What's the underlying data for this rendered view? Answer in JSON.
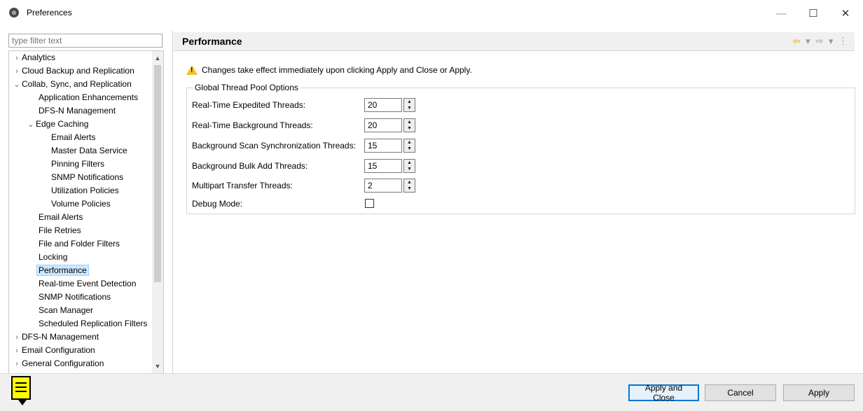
{
  "window": {
    "title": "Preferences",
    "minimize": "—",
    "maximize": "☐",
    "close": "✕"
  },
  "filter": {
    "placeholder": "type filter text"
  },
  "tree": {
    "items": [
      {
        "label": "Analytics",
        "twisty": "›"
      },
      {
        "label": "Cloud Backup and Replication",
        "twisty": "›"
      },
      {
        "label": "Collab, Sync, and Replication",
        "twisty": "⌄"
      },
      {
        "label": "Application Enhancements",
        "twisty": ""
      },
      {
        "label": "DFS-N Management",
        "twisty": ""
      },
      {
        "label": "Edge Caching",
        "twisty": "⌄"
      },
      {
        "label": "Email Alerts",
        "twisty": ""
      },
      {
        "label": "Master Data Service",
        "twisty": ""
      },
      {
        "label": "Pinning Filters",
        "twisty": ""
      },
      {
        "label": "SNMP Notifications",
        "twisty": ""
      },
      {
        "label": "Utilization Policies",
        "twisty": ""
      },
      {
        "label": "Volume Policies",
        "twisty": ""
      },
      {
        "label": "Email Alerts",
        "twisty": ""
      },
      {
        "label": "File Retries",
        "twisty": ""
      },
      {
        "label": "File and Folder Filters",
        "twisty": ""
      },
      {
        "label": "Locking",
        "twisty": ""
      },
      {
        "label": "Performance",
        "twisty": ""
      },
      {
        "label": "Real-time Event Detection",
        "twisty": ""
      },
      {
        "label": "SNMP Notifications",
        "twisty": ""
      },
      {
        "label": "Scan Manager",
        "twisty": ""
      },
      {
        "label": "Scheduled Replication Filters",
        "twisty": ""
      },
      {
        "label": "DFS-N Management",
        "twisty": "›"
      },
      {
        "label": "Email Configuration",
        "twisty": "›"
      },
      {
        "label": "General Configuration",
        "twisty": "›"
      }
    ],
    "scroll_up": "▲",
    "scroll_down": "▼"
  },
  "page": {
    "title": "Performance",
    "nav": {
      "back": "⇦",
      "back_menu": "▾",
      "forward": "⇨",
      "forward_menu": "▾",
      "more": "⋮"
    },
    "notice": "Changes take effect immediately upon clicking Apply and Close or Apply.",
    "group_title": "Global Thread Pool Options",
    "fields": [
      {
        "label": "Real-Time Expedited Threads:",
        "value": "20"
      },
      {
        "label": "Real-Time Background Threads:",
        "value": "20"
      },
      {
        "label": "Background Scan Synchronization Threads:",
        "value": "15"
      },
      {
        "label": "Background Bulk Add Threads:",
        "value": "15"
      },
      {
        "label": "Multipart Transfer Threads:",
        "value": "2"
      }
    ],
    "debug_label": "Debug Mode:",
    "debug_checked": false
  },
  "buttons": {
    "apply_close": "Apply and Close",
    "cancel": "Cancel",
    "apply": "Apply"
  },
  "colors": {
    "selection": "#cce8ff",
    "default_button_border": "#0078d7",
    "warning": "#f2c12e",
    "help_icon": "#ffff00"
  }
}
